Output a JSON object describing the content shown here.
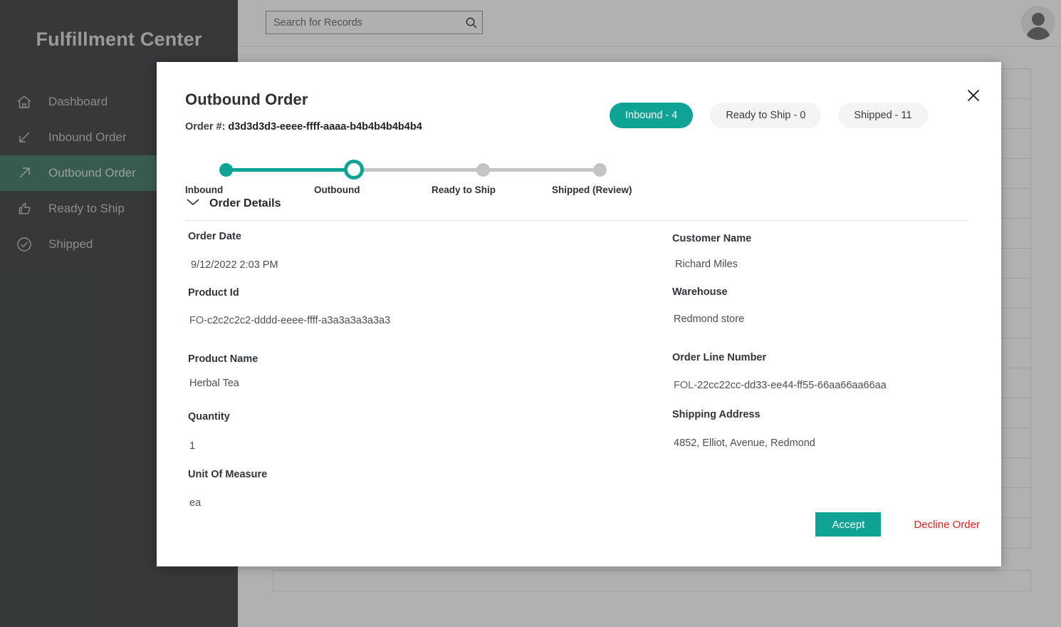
{
  "app": {
    "brand": "Fulfillment Center",
    "accent_teal": "#0fa396",
    "sidebar_bg": "#2b2f31",
    "sidebar_active_bg": "#2f6b5b",
    "decline_red": "#e02020"
  },
  "sidebar": {
    "items": [
      {
        "label": "Dashboard",
        "icon": "home-icon",
        "active": false
      },
      {
        "label": "Inbound Order",
        "icon": "arrow-down-left-icon",
        "active": false
      },
      {
        "label": "Outbound Order",
        "icon": "arrow-up-right-icon",
        "active": true
      },
      {
        "label": "Ready to Ship",
        "icon": "thumbs-up-icon",
        "active": false
      },
      {
        "label": "Shipped",
        "icon": "check-circle-icon",
        "active": false
      }
    ]
  },
  "topbar": {
    "search": {
      "placeholder": "Search for Records",
      "value": "",
      "icon": "search-icon"
    },
    "avatar_icon": "user-avatar-icon"
  },
  "modal": {
    "title": "Outbound Order",
    "order_number_label": "Order #:",
    "order_number_value": "d3d3d3d3-eeee-ffff-aaaa-b4b4b4b4b4b4",
    "close_icon": "close-icon",
    "status_pills": [
      {
        "label": "Inbound - 4",
        "active": true
      },
      {
        "label": "Ready to Ship - 0",
        "active": false
      },
      {
        "label": "Shipped - 11",
        "active": false
      }
    ],
    "stepper": {
      "steps": [
        {
          "label": "Inbound",
          "state": "done"
        },
        {
          "label": "Outbound",
          "state": "current"
        },
        {
          "label": "Ready to Ship",
          "state": "todo"
        },
        {
          "label": "Shipped (Review)",
          "state": "todo"
        }
      ]
    },
    "details_section": {
      "caption": "Order Details",
      "chevron_icon": "chevron-down-icon",
      "expanded": true
    },
    "fields_left": {
      "order_date_label": "Order Date",
      "order_date_value": "9/12/2022 2:03 PM",
      "product_id_label": "Product Id",
      "product_id_prefix": "FO-",
      "product_id_value": "c2c2c2c2-dddd-eeee-ffff-a3a3a3a3a3a3",
      "product_name_label": "Product Name",
      "product_name_value": "Herbal Tea",
      "quantity_label": "Quantity",
      "quantity_value": "1",
      "uom_label": "Unit Of Measure",
      "uom_value": "ea"
    },
    "fields_right": {
      "customer_name_label": "Customer Name",
      "customer_name_value": "Richard Miles",
      "warehouse_label": "Warehouse",
      "warehouse_value": "Redmond store",
      "order_line_number_label": "Order Line Number",
      "order_line_number_prefix": "FOL-",
      "order_line_number_value": "22cc22cc-dd33-ee44-ff55-66aa66aa66aa",
      "shipping_address_label": "Shipping Address",
      "shipping_address_value": "4852, Elliot, Avenue, Redmond"
    },
    "actions": {
      "accept_label": "Accept",
      "decline_label": "Decline Order"
    }
  }
}
